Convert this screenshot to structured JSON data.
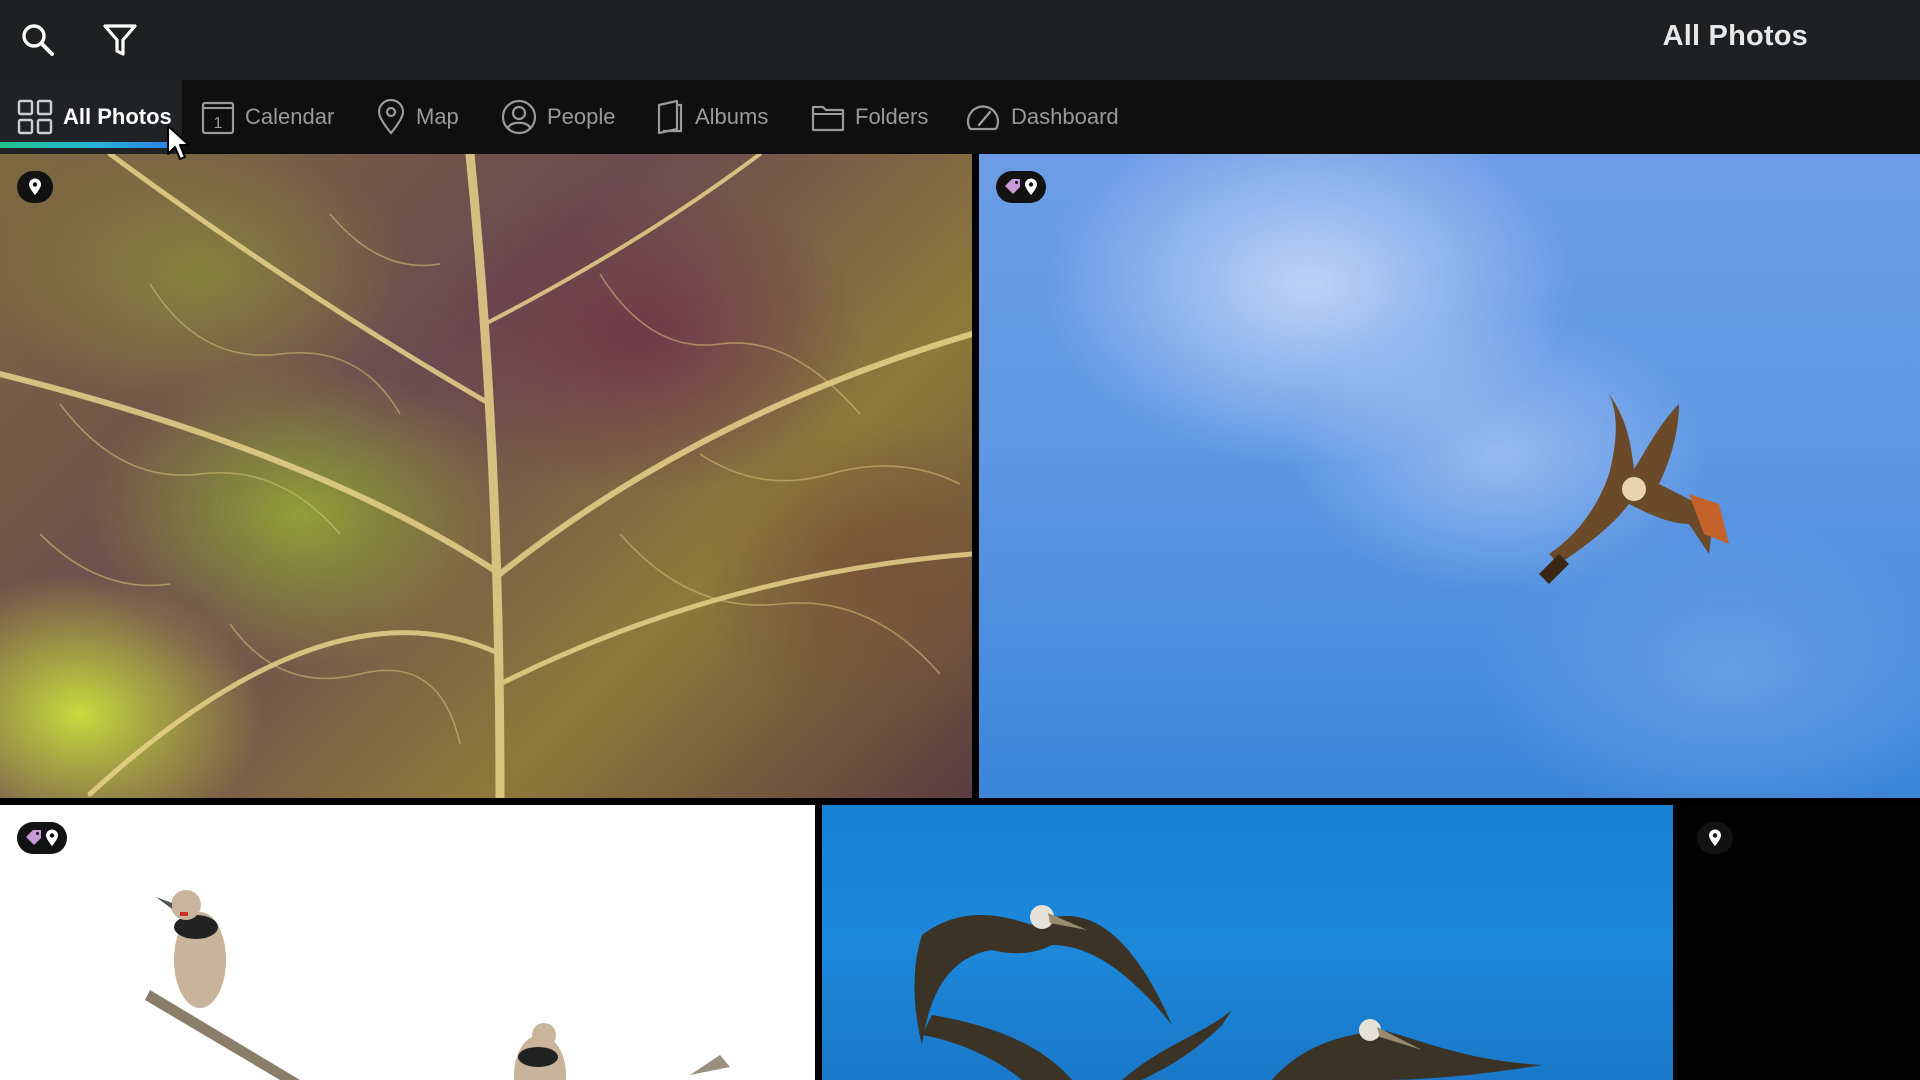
{
  "header": {
    "title": "All Photos",
    "search_icon": "search-icon",
    "filter_icon": "filter-icon"
  },
  "nav": {
    "items": [
      {
        "label": "All Photos",
        "icon": "grid-icon",
        "active": true
      },
      {
        "label": "Calendar",
        "icon": "calendar-icon",
        "active": false,
        "icon_text": "1"
      },
      {
        "label": "Map",
        "icon": "map-pin-icon",
        "active": false
      },
      {
        "label": "People",
        "icon": "person-icon",
        "active": false
      },
      {
        "label": "Albums",
        "icon": "album-icon",
        "active": false
      },
      {
        "label": "Folders",
        "icon": "folder-icon",
        "active": false
      },
      {
        "label": "Dashboard",
        "icon": "gauge-icon",
        "active": false
      }
    ],
    "active_underline_colors": [
      "#1fc28c",
      "#27b4d6",
      "#2d83e6"
    ]
  },
  "photos": [
    {
      "subject": "leaf",
      "badges": [
        "location-pin-icon"
      ]
    },
    {
      "subject": "hawk",
      "badges": [
        "tag-icon",
        "location-pin-icon"
      ]
    },
    {
      "subject": "flicker birds",
      "badges": [
        "tag-icon",
        "location-pin-icon"
      ]
    },
    {
      "subject": "pelicans",
      "badges": []
    },
    {
      "subject": "dark",
      "badges": [
        "location-pin-icon"
      ]
    }
  ],
  "colors": {
    "topbar_bg": "#1f2022",
    "navbar_bg": "#0f0f0f",
    "active_tab_bg": "#202225",
    "tag_color": "#c89ad8"
  }
}
